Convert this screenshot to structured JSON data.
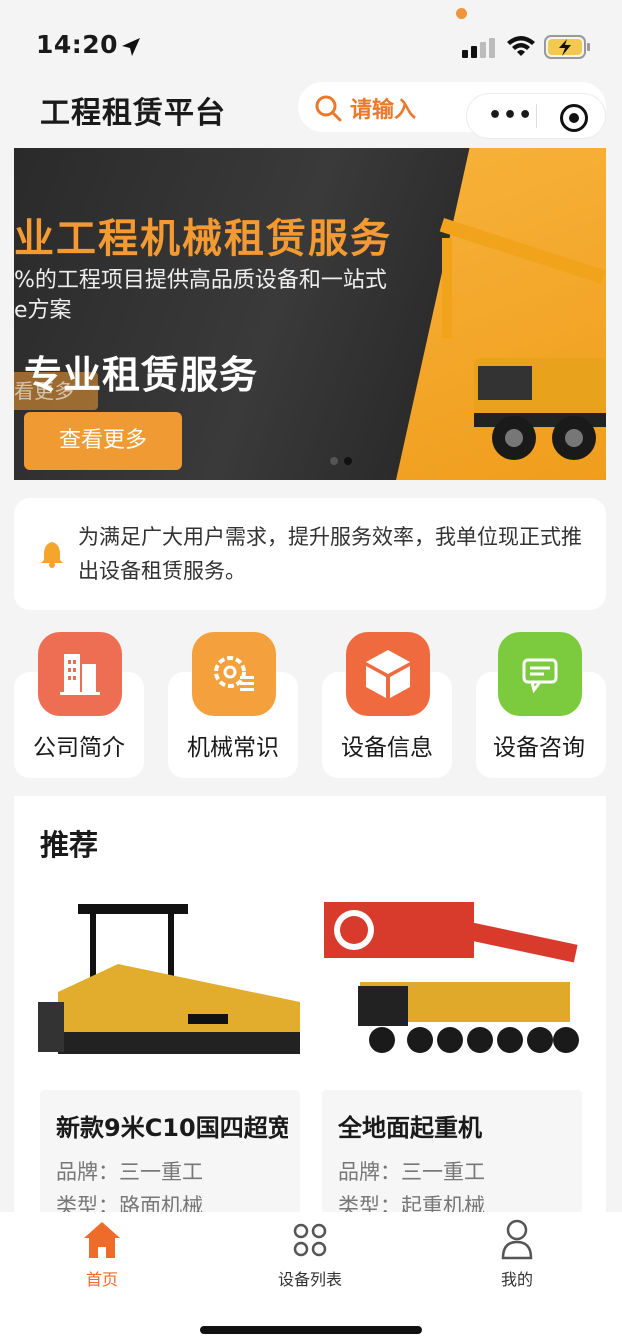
{
  "status": {
    "time": "14:20"
  },
  "header": {
    "title": "工程租赁平台",
    "search_placeholder": "请输入"
  },
  "banner": {
    "title": "业工程机械租赁服务",
    "subtitle_line1": "%的工程项目提供高品质设备和一站式",
    "subtitle_line2": "e方案",
    "ghost_button": "看更多",
    "headline": "专业租赁服务",
    "button": "查看更多"
  },
  "notice": {
    "text": "为满足广大用户需求，提升服务效率，我单位现正式推出设备租赁服务。"
  },
  "categories": [
    {
      "label": "公司简介",
      "icon": "building-icon",
      "color": "#ee6e54"
    },
    {
      "label": "机械常识",
      "icon": "gear-list-icon",
      "color": "#f4a03d"
    },
    {
      "label": "设备信息",
      "icon": "cube-icon",
      "color": "#ef6b3f"
    },
    {
      "label": "设备咨询",
      "icon": "chat-icon",
      "color": "#7ccb3f"
    }
  ],
  "recommend": {
    "title": "推荐",
    "items": [
      {
        "name": "新款9米C10国四超宽",
        "brand": "品牌：三一重工",
        "type": "类型：路面机械"
      },
      {
        "name": "全地面起重机",
        "brand": "品牌：三一重工",
        "type": "类型：起重机械"
      }
    ]
  },
  "tabbar": [
    {
      "label": "首页",
      "icon": "home-icon",
      "active": true
    },
    {
      "label": "设备列表",
      "icon": "grid-icon",
      "active": false
    },
    {
      "label": "我的",
      "icon": "user-icon",
      "active": false
    }
  ],
  "colors": {
    "accent": "#e97a2b",
    "tab_active": "#ef6b2a"
  }
}
